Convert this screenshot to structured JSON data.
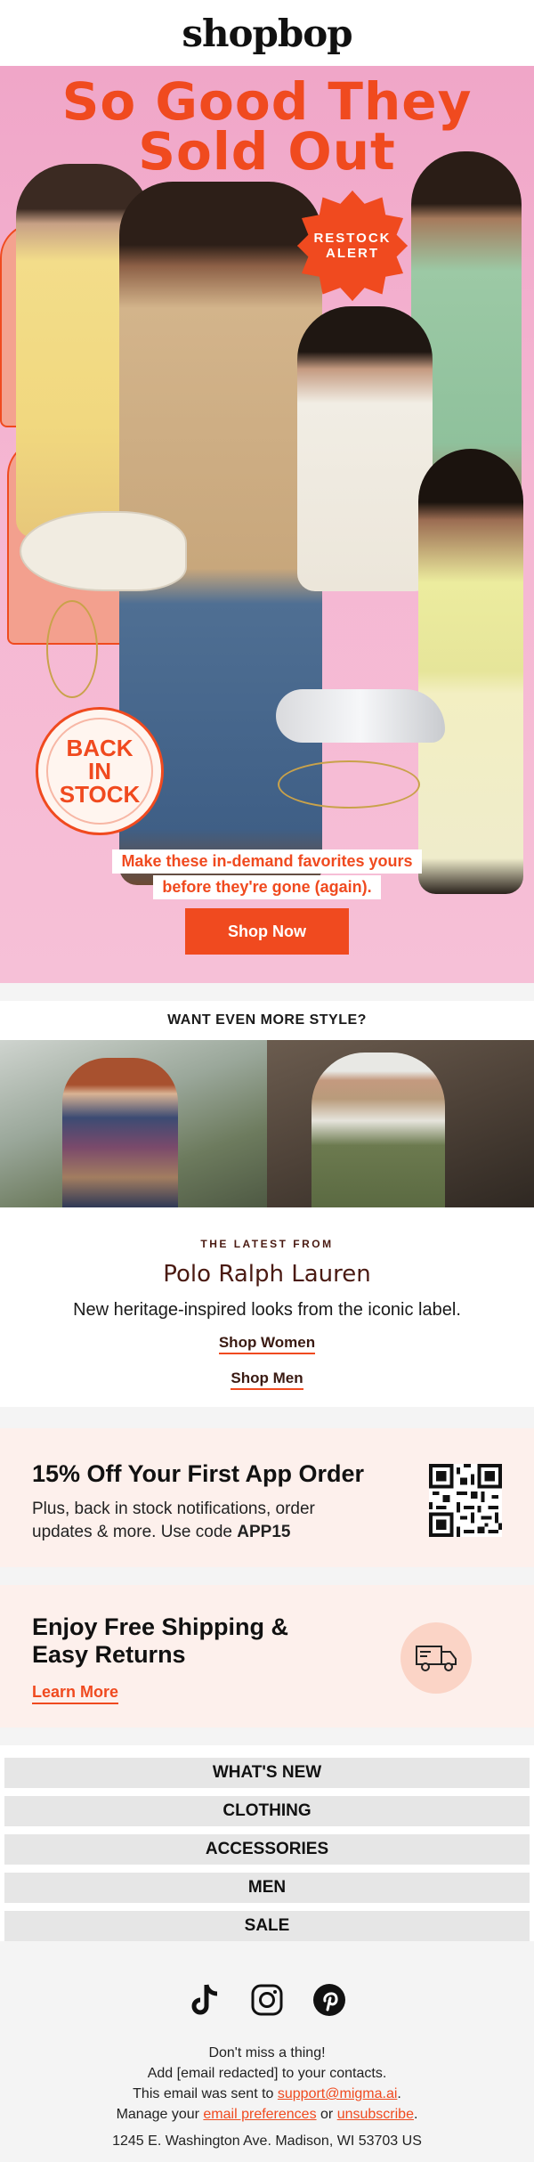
{
  "brand": {
    "logo": "shopbop"
  },
  "hero": {
    "title_line1": "So Good They",
    "title_line2": "Sold Out",
    "restock_badge": "RESTOCK ALERT",
    "back_in_stock": [
      "BACK",
      "IN",
      "STOCK"
    ],
    "subtitle_line1": "Make these in-demand favorites yours",
    "subtitle_line2": "before they're gone (again).",
    "cta": "Shop Now",
    "colors": {
      "accent": "#f04a1f",
      "background": "#f5b6d2"
    }
  },
  "more_style": {
    "heading": "WANT EVEN MORE STYLE?"
  },
  "latest": {
    "kicker": "THE LATEST FROM",
    "brand": "Polo Ralph Lauren",
    "description": "New heritage-inspired looks from the iconic label.",
    "link_women": "Shop Women",
    "link_men": "Shop Men"
  },
  "app_promo": {
    "title": "15% Off Your First App Order",
    "description_prefix": "Plus, back in stock notifications, order updates & more. Use code ",
    "code": "APP15"
  },
  "shipping": {
    "title": "Enjoy Free Shipping & Easy Returns",
    "link": "Learn More",
    "icon": "truck-icon"
  },
  "nav": {
    "items": [
      "WHAT'S NEW",
      "CLOTHING",
      "ACCESSORIES",
      "MEN",
      "SALE"
    ]
  },
  "footer": {
    "socials": [
      "tiktok-icon",
      "instagram-icon",
      "pinterest-icon"
    ],
    "line1": "Don't miss a thing!",
    "line2": "Add [email redacted] to your contacts.",
    "line3_prefix": "This email was sent to ",
    "line3_email": "support@migma.ai",
    "line3_suffix": ".",
    "line4_prefix": "Manage your ",
    "line4_prefs": "email preferences",
    "line4_or": " or ",
    "line4_unsub": "unsubscribe",
    "line4_suffix": ".",
    "address": "1245 E. Washington Ave. Madison, WI 53703 US"
  }
}
